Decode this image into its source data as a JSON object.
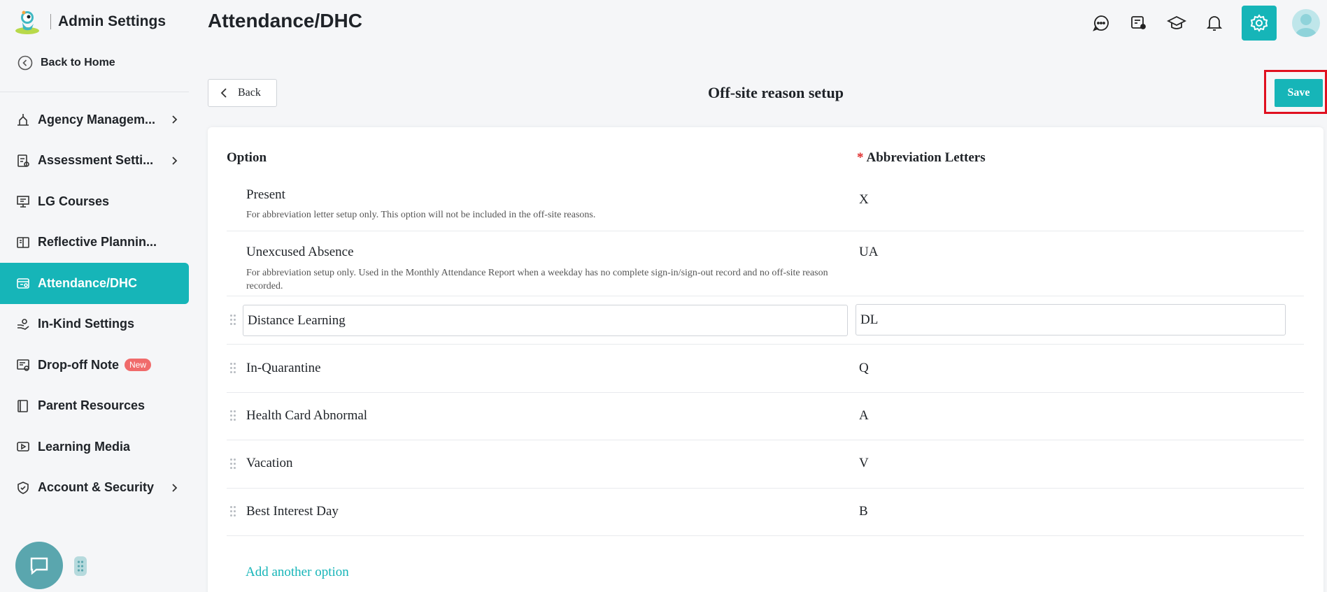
{
  "brand": {
    "title": "Admin Settings"
  },
  "back_home": "Back to Home",
  "sidebar": {
    "items": [
      {
        "label": "Agency Managem...",
        "icon": "agency-icon",
        "has_chevron": true
      },
      {
        "label": "Assessment Setti...",
        "icon": "assessment-icon",
        "has_chevron": true
      },
      {
        "label": "LG Courses",
        "icon": "courses-icon",
        "has_chevron": false
      },
      {
        "label": "Reflective Plannin...",
        "icon": "book-icon",
        "has_chevron": false
      },
      {
        "label": "Attendance/DHC",
        "icon": "attendance-icon",
        "has_chevron": false,
        "active": true
      },
      {
        "label": "In-Kind Settings",
        "icon": "hand-icon",
        "has_chevron": false
      },
      {
        "label": "Drop-off Note",
        "icon": "note-icon",
        "has_chevron": false,
        "badge": "New"
      },
      {
        "label": "Parent Resources",
        "icon": "resources-icon",
        "has_chevron": false
      },
      {
        "label": "Learning Media",
        "icon": "media-icon",
        "has_chevron": false
      },
      {
        "label": "Account & Security",
        "icon": "shield-icon",
        "has_chevron": true
      }
    ]
  },
  "header": {
    "title": "Attendance/DHC"
  },
  "toolbar": {
    "back_label": "Back",
    "section_title": "Off-site reason setup",
    "save_label": "Save"
  },
  "table": {
    "col_option": "Option",
    "col_required_mark": "*",
    "col_abbr": "Abbreviation Letters",
    "rows": [
      {
        "name": "Present",
        "desc": "For abbreviation letter setup only. This option will not be included in the off-site reasons.",
        "abbr": "X"
      },
      {
        "name": "Unexcused Absence",
        "desc": "For abbreviation setup only. Used in the Monthly Attendance Report when a weekday has no complete sign-in/sign-out record and no off-site reason recorded.",
        "abbr": "UA"
      },
      {
        "name": "Distance Learning",
        "abbr": "DL",
        "editing": true
      },
      {
        "name": "In-Quarantine",
        "abbr": "Q"
      },
      {
        "name": "Health Card Abnormal",
        "abbr": "A"
      },
      {
        "name": "Vacation",
        "abbr": "V"
      },
      {
        "name": "Best Interest Day",
        "abbr": "B"
      }
    ],
    "add_option": "Add another option"
  },
  "colors": {
    "accent": "#16b5b8",
    "highlight": "#e01020",
    "badge": "#f06b6b"
  }
}
